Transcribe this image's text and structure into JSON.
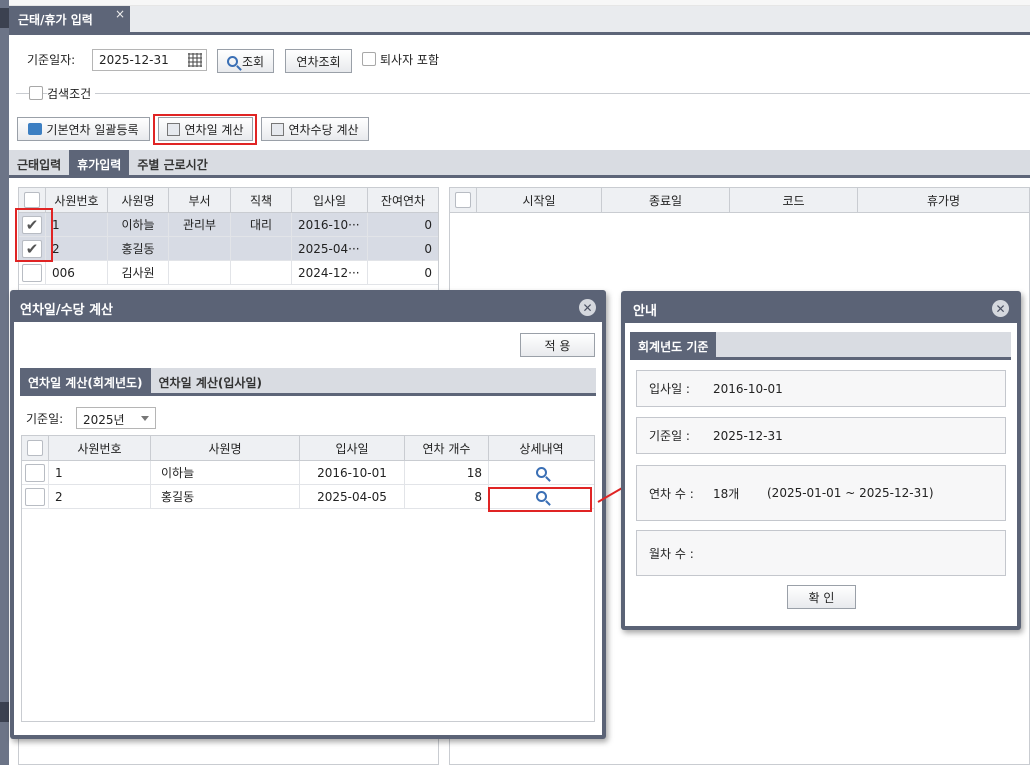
{
  "app": {
    "tab_title": "근태/휴가 입력",
    "tab_close": "×"
  },
  "search": {
    "date_label": "기준일자:",
    "date_value": "2025-12-31",
    "query_button": "조회",
    "annual_query_button": "연차조회",
    "include_retired": "퇴사자 포함",
    "search_conditions": "검색조건"
  },
  "toolbar": {
    "bulk_register": "기본연차 일괄등록",
    "annual_calc": "연차일 계산",
    "allowance_calc": "연차수당 계산"
  },
  "subtabs": [
    "근태입력",
    "휴가입력",
    "주별 근로시간"
  ],
  "left_grid": {
    "columns": [
      "사원번호",
      "사원명",
      "부서",
      "직책",
      "입사일",
      "잔여연차"
    ],
    "rows": [
      {
        "checked": true,
        "emp_no": "1",
        "name": "이하늘",
        "dept": "관리부",
        "position": "대리",
        "hire": "2016-10···",
        "remain": "0"
      },
      {
        "checked": true,
        "emp_no": "2",
        "name": "홍길동",
        "dept": "",
        "position": "",
        "hire": "2025-04···",
        "remain": "0"
      },
      {
        "checked": false,
        "emp_no": "006",
        "name": "김사원",
        "dept": "",
        "position": "",
        "hire": "2024-12···",
        "remain": "0"
      }
    ]
  },
  "right_grid": {
    "columns": [
      "시작일",
      "종료일",
      "코드",
      "휴가명"
    ]
  },
  "calc_dialog": {
    "title": "연차일/수당 계산",
    "apply_button": "적 용",
    "tabs": [
      "연차일 계산(회계년도)",
      "연차일 계산(입사일)"
    ],
    "base_label": "기준일:",
    "base_year": "2025년",
    "columns": [
      "사원번호",
      "사원명",
      "입사일",
      "연차 개수",
      "상세내역"
    ],
    "rows": [
      {
        "emp_no": "1",
        "name": "이하늘",
        "hire": "2016-10-01",
        "count": "18"
      },
      {
        "emp_no": "2",
        "name": "홍길동",
        "hire": "2025-04-05",
        "count": "8"
      }
    ]
  },
  "info_dialog": {
    "title": "안내",
    "tab": "회계년도 기준",
    "hire_label": "입사일 :",
    "hire_value": "2016-10-01",
    "base_label": "기준일 :",
    "base_value": "2025-12-31",
    "count_label": "연차 수 :",
    "count_value": "18개",
    "count_range": "(2025-01-01 ~ 2025-12-31)",
    "monthly_label": "월차 수 :",
    "ok_button": "확 인"
  },
  "colors": {
    "accent": "#5d6578",
    "highlight": "#e02424",
    "selected_row": "#d7dbe4"
  }
}
